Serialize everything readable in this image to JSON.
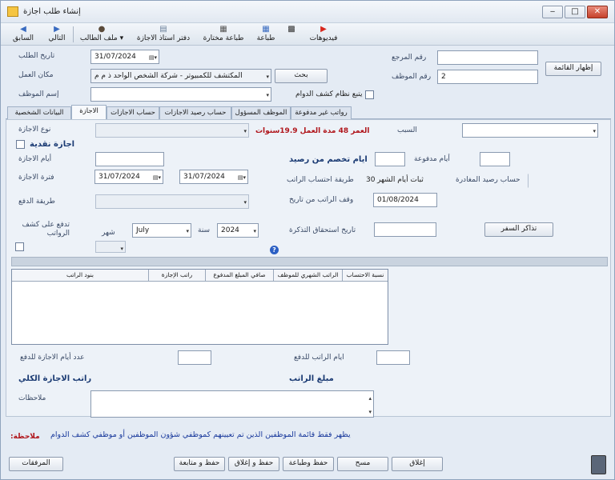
{
  "window": {
    "title": "إنشاء طلب اجازة",
    "buttons": [
      "‒",
      "□",
      "✕"
    ]
  },
  "toolbar": {
    "videos": "فيديوهات",
    "print": "طباعة",
    "print_selected": "طباعة مختارة",
    "leave_book": "دفتر استاذ الاجازة",
    "requester_file": "ملف الطالب",
    "next": "التالي",
    "prev": "السابق"
  },
  "header": {
    "ref_no_label": "رقم المرجع",
    "ref_no_value": "",
    "emp_no_label": "رقم الموظف",
    "emp_no_value": "2",
    "show_list_button": "إظهار القائمة",
    "request_date_label": "تاريخ الطلب",
    "request_date_value": "31/07/2024",
    "workplace_label": "مكان العمل",
    "workplace_value": "المكتشف للكمبيوتر - شركة الشخص الواحد ذ م م",
    "search_button": "بحث",
    "attendance_label": "يتبع نظام كشف الدوام",
    "emp_name_label": "إسم الموظف",
    "emp_name_value": ""
  },
  "tabs": [
    "البيانات الشخصية",
    "الاجازة",
    "حساب الاجازات",
    "حساب رصيد الاجازات",
    "الموظف المسؤول",
    "رواتب غير مدفوعة"
  ],
  "leave": {
    "leave_type_label": "نوع الاجازة",
    "leave_type_value": "",
    "age_service": "العمر 48  مدة العمل 19.9سنوات",
    "reason_label": "السبب",
    "reason_value": "",
    "cash_leave_label": "اجازة نقدية",
    "days_label": "أيام الاجازة",
    "days_value": "",
    "deduct_label": "ايام تخصم من رصيد",
    "deduct_value": "",
    "paid_days_label": "أيام مدفوعة",
    "paid_days_value": "",
    "period_label": "فترة الاجازة",
    "from_date": "31/07/2024",
    "to_date": "31/07/2024",
    "salary_method_label": "طريقة احتساب الراتب",
    "salary_method_value": "ثبات أيام الشهر",
    "month_days": "30",
    "departure_balance_label": "حساب رصيد المغادرة",
    "departure_balance_value": "",
    "payment_method_label": "طريقة الدفع",
    "payment_method_value": "",
    "stop_salary_label": "وقف الراتب من تاريخ",
    "stop_salary_value": "01/08/2024",
    "pay_on_label": "تدفع على كشف الرواتب",
    "month_label": "شهر",
    "month_value": "July",
    "year_label": "سنة",
    "year_value": "2024",
    "ticket_due_label": "تاريخ استحقاق التذكرة",
    "ticket_due_value": "",
    "tickets_button": "تذاكر السفر"
  },
  "grid": {
    "headers": [
      "نسبة الاحتساب",
      "الراتب الشهري للموظف",
      "صافي المبلغ المدفوع",
      "راتب الإجازة",
      "بنود الراتب"
    ]
  },
  "totals": {
    "paid_days_count_label": "عدد أيام الاجازة للدفع",
    "paid_days_count_value": "",
    "salary_days_label": "ايام الراتب للدفع",
    "salary_days_value": "",
    "total_leave_salary_label": "راتب الاجازة الكلي",
    "salary_amount_label": "مبلغ الراتب",
    "notes_label": "ملاحظات",
    "notes_value": ""
  },
  "footer": {
    "note_label": "ملاحظة:",
    "note_text": "يظهر فقط قائمة الموظفين الذين تم تعيينهم كموظفي شؤون الموظفين أو موظفي كشف الدوام",
    "attachments": "المرفقات",
    "save_follow": "حفظ و متابعة",
    "save_close": "حفظ و إغلاق",
    "save_print": "حفظ وطباعة",
    "clear": "مسح",
    "close": "إغلاق"
  }
}
